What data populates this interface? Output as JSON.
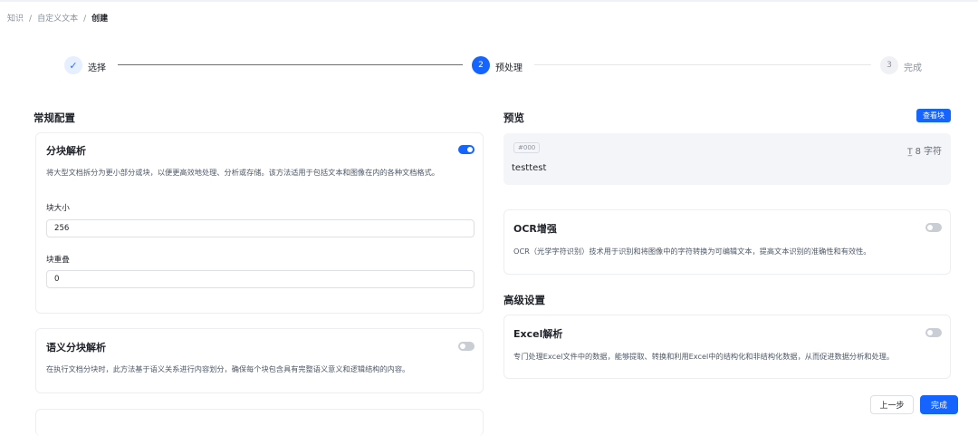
{
  "breadcrumb": {
    "items": [
      "知识",
      "自定义文本"
    ],
    "separator": "/",
    "current": "创建"
  },
  "steps": [
    {
      "index": "✓",
      "label": "选择",
      "state": "completed"
    },
    {
      "index": "2",
      "label": "预处理",
      "state": "active"
    },
    {
      "index": "3",
      "label": "完成",
      "state": "pending"
    }
  ],
  "general": {
    "title": "常规配置",
    "chunk_parse": {
      "title": "分块解析",
      "enabled": true,
      "description": "将大型文档拆分为更小部分或块，以便更高效地处理、分析或存储。该方法适用于包括文本和图像在内的各种文档格式。",
      "chunk_size_label": "块大小",
      "chunk_size_value": "256",
      "chunk_overlap_label": "块重叠",
      "chunk_overlap_value": "0"
    },
    "semantic_parse": {
      "title": "语义分块解析",
      "enabled": false,
      "description": "在执行文档分块时，此方法基于语义关系进行内容划分，确保每个块包含具有完整语义意义和逻辑结构的内容。"
    }
  },
  "preview": {
    "title": "预览",
    "view_chunks_label": "查看块",
    "chunk_tag": "#000",
    "chunk_text": "testtest",
    "char_count": "8",
    "char_unit": "字符",
    "char_icon": "text-size-icon"
  },
  "ocr": {
    "title": "OCR增强",
    "enabled": false,
    "description": "OCR（光学字符识别）技术用于识别和将图像中的字符转换为可编辑文本，提高文本识别的准确性和有效性。"
  },
  "advanced": {
    "title": "高级设置",
    "excel": {
      "title": "Excel解析",
      "enabled": false,
      "description": "专门处理Excel文件中的数据，能够提取、转换和利用Excel中的结构化和非结构化数据，从而促进数据分析和处理。"
    }
  },
  "footer": {
    "prev_label": "上一步",
    "done_label": "完成"
  },
  "colors": {
    "primary": "#1664ff",
    "toggle_off": "#c9cdd4"
  }
}
